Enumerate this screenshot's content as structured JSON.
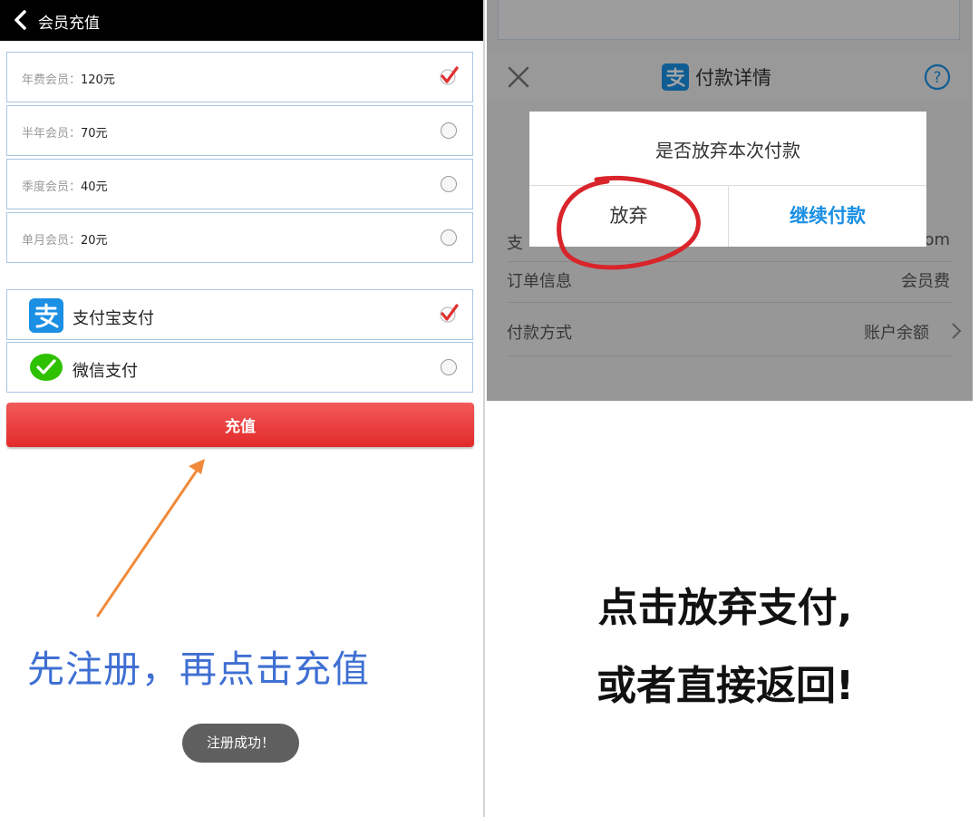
{
  "left": {
    "header": {
      "title": "会员充值"
    },
    "plans": [
      {
        "name": "年费会员：",
        "price": "120元",
        "selected": true
      },
      {
        "name": "半年会员：",
        "price": "70元",
        "selected": false
      },
      {
        "name": "季度会员：",
        "price": "40元",
        "selected": false
      },
      {
        "name": "单月会员：",
        "price": "20元",
        "selected": false
      }
    ],
    "payment_methods": [
      {
        "label": "支付宝支付",
        "icon": "alipay-icon",
        "selected": true
      },
      {
        "label": "微信支付",
        "icon": "wechat-icon",
        "selected": false
      }
    ],
    "recharge_button": "充值",
    "hint": "先注册，再点击充值",
    "toast": "注册成功！"
  },
  "right": {
    "payment_sheet": {
      "title": "付款详情",
      "rows": [
        {
          "label": "支",
          "value": "om"
        },
        {
          "label": "订单信息",
          "value": "会员费"
        },
        {
          "label": "付款方式",
          "value": "账户余额"
        }
      ]
    },
    "dialog": {
      "message": "是否放弃本次付款",
      "abandon": "放弃",
      "continue": "继续付款"
    },
    "hint_line1": "点击放弃支付,",
    "hint_line2": "或者直接返回!"
  },
  "colors": {
    "accent_red": "#e22a2a",
    "hint_blue": "#3f6fd3",
    "alipay_blue": "#1a8fe3",
    "wechat_green": "#2dc100",
    "arrow_orange": "#f08a3a"
  }
}
